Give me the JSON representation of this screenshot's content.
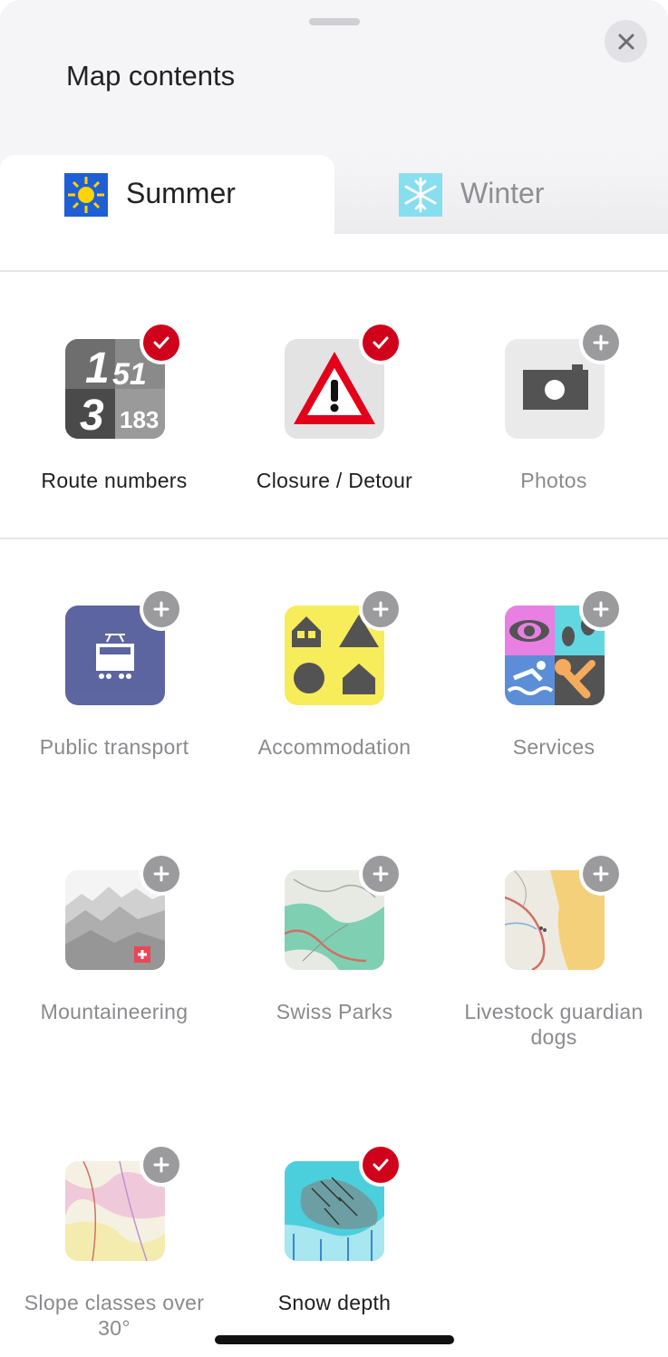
{
  "sheet": {
    "title": "Map contents",
    "close_icon": "close-icon"
  },
  "tabs": [
    {
      "label": "Summer",
      "icon": "sun-icon",
      "selected": true
    },
    {
      "label": "Winter",
      "icon": "snowflake-icon",
      "selected": false
    }
  ],
  "colors": {
    "active_badge": "#d0021b",
    "inactive_badge": "#9b9b9e",
    "sheet_background": "#f5f5f7",
    "text_active": "#1f1f1f",
    "text_inactive": "#8a8a8e"
  },
  "layers": [
    {
      "label": "Route numbers",
      "icon": "route-numbers-icon",
      "enabled": true
    },
    {
      "label": "Closure / Detour",
      "icon": "warning-triangle-icon",
      "enabled": true
    },
    {
      "label": "Photos",
      "icon": "camera-icon",
      "enabled": false
    },
    {
      "label": "Public transport",
      "icon": "train-icon",
      "enabled": false
    },
    {
      "label": "Accommodation",
      "icon": "accommodation-icon",
      "enabled": false
    },
    {
      "label": "Services",
      "icon": "services-icon",
      "enabled": false
    },
    {
      "label": "Mountaineering",
      "icon": "mountains-icon",
      "enabled": false
    },
    {
      "label": "Swiss Parks",
      "icon": "swiss-parks-map-icon",
      "enabled": false
    },
    {
      "label": "Livestock guardian dogs",
      "icon": "livestock-map-icon",
      "enabled": false
    },
    {
      "label": "Slope classes over 30°",
      "icon": "slope-map-icon",
      "enabled": false
    },
    {
      "label": "Snow depth",
      "icon": "snow-depth-map-icon",
      "enabled": true
    }
  ],
  "route_numbers_tile": {
    "a": "1",
    "b": "51",
    "c": "3",
    "d": "183"
  }
}
